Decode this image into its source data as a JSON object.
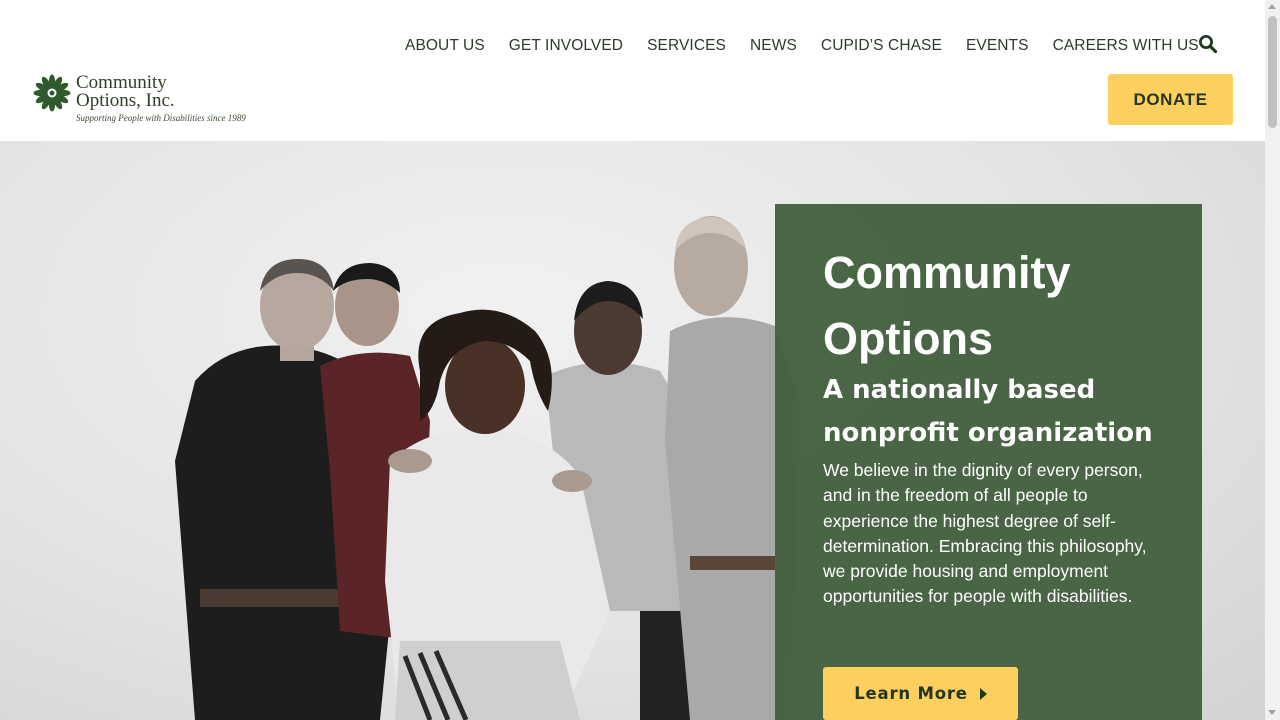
{
  "logo": {
    "name": "Community\nOptions, Inc.",
    "tagline": "Supporting People with Disabilities since 1989",
    "icon": "flower-logo-icon",
    "color": "#2f5a2c"
  },
  "nav": {
    "items": [
      {
        "label": "ABOUT US"
      },
      {
        "label": "GET INVOLVED"
      },
      {
        "label": "SERVICES"
      },
      {
        "label": "NEWS"
      },
      {
        "label": "CUPID’S CHASE"
      },
      {
        "label": "EVENTS"
      },
      {
        "label": "CAREERS WITH US"
      }
    ],
    "search_icon": "search-icon"
  },
  "header": {
    "donate_label": "DONATE",
    "donate_color": "#fdcf5e"
  },
  "hero": {
    "photo_description_icon": "group-photo",
    "panel_color": "#43603e",
    "title": "Community Options",
    "subtitle": "A nationally based nonprofit organization",
    "body": "We believe in the dignity of every person, and in the freedom of all people to experience the highest degree of self-determination. Embracing this philosophy, we provide housing and employment opportunities for people with disabilities.",
    "cta_label": "Learn More",
    "cta_icon": "caret-right-icon"
  }
}
